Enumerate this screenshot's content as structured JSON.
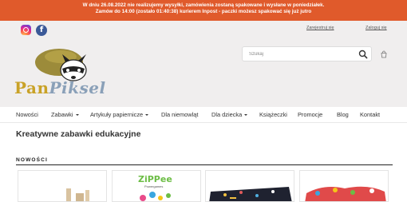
{
  "announcement": {
    "line1": "W dniu 26.08.2022 nie realizujemy wysyłki, zamówienia zostaną spakowane i wysłane w poniedziałek.",
    "line2": "Zamów do 14:00 (zostało 01:40:38) kurierem Inpost - paczki możesz spakować się już jutro"
  },
  "header": {
    "register_label": "Zarejestruj się",
    "login_label": "Zaloguj się",
    "facebook_letter": "f",
    "logo": {
      "text_part1": "Pan",
      "text_part2": "Piksel"
    },
    "search": {
      "placeholder": "Szukaj"
    }
  },
  "nav": {
    "items": [
      {
        "label": "Nowości"
      },
      {
        "label": "Zabawki"
      },
      {
        "label": "Artykuły papiernicze"
      },
      {
        "label": "Dla niemowląt"
      },
      {
        "label": "Dla dziecka"
      },
      {
        "label": "Książeczki"
      },
      {
        "label": "Promocje"
      },
      {
        "label": "Blog"
      },
      {
        "label": "Kontakt"
      }
    ]
  },
  "main": {
    "title": "Kreatywne zabawki edukacyjne",
    "section_title": "NOWOŚCI",
    "products": [
      {
        "brand_text": ""
      },
      {
        "brand_text": "ZiPPee",
        "brand_sub": "Powergames"
      },
      {
        "brand_text": ""
      },
      {
        "brand_text": ""
      }
    ]
  },
  "colors": {
    "announcement_bg": "#e05a2b",
    "header_bg": "#f0eeee",
    "facebook": "#3b5998"
  }
}
